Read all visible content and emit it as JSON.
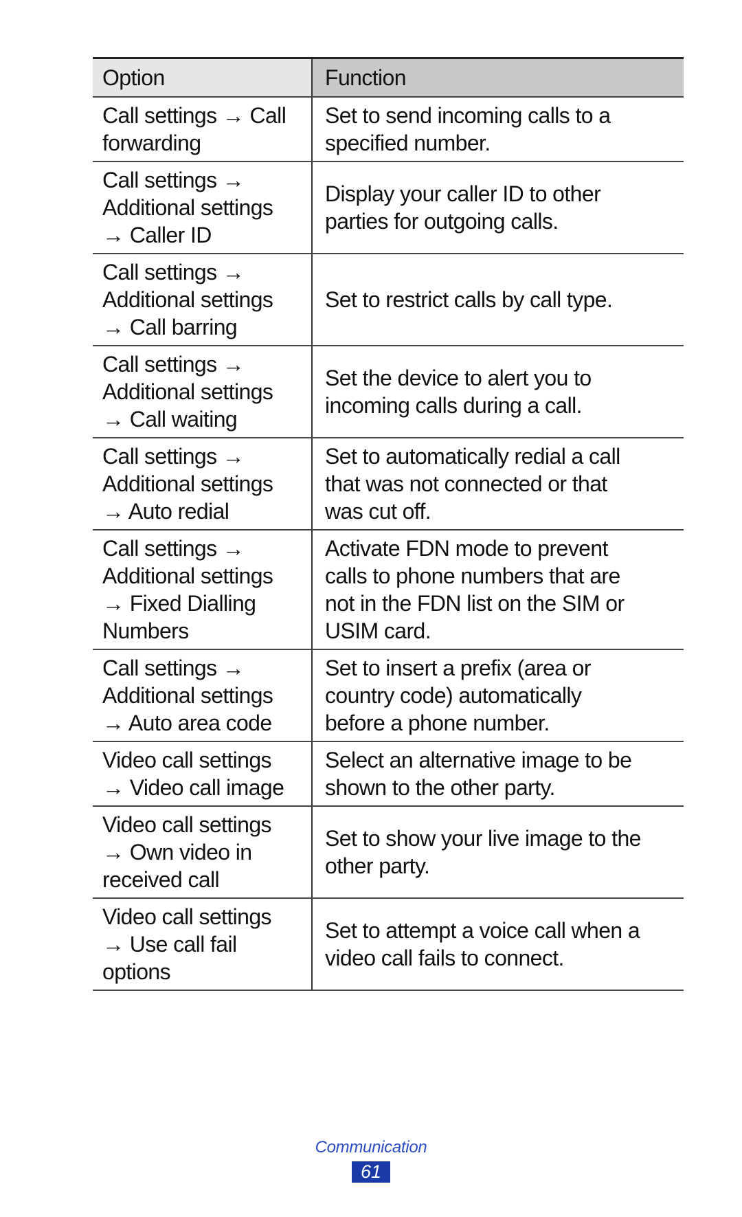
{
  "table": {
    "headers": {
      "option": "Option",
      "function": "Function"
    },
    "rows": [
      {
        "option": [
          "Call settings → Call",
          "forwarding"
        ],
        "function": [
          "Set to send incoming calls to a",
          "specified number."
        ]
      },
      {
        "option": [
          "Call settings →",
          "Additional settings",
          "→ Caller ID"
        ],
        "function": [
          "Display your caller ID to other",
          "parties for outgoing calls."
        ]
      },
      {
        "option": [
          "Call settings →",
          "Additional settings",
          "→ Call barring"
        ],
        "function": [
          "Set to restrict calls by call type."
        ]
      },
      {
        "option": [
          "Call settings →",
          "Additional settings",
          "→ Call waiting"
        ],
        "function": [
          "Set the device to alert you to",
          "incoming calls during a call."
        ]
      },
      {
        "option": [
          "Call settings →",
          "Additional settings",
          "→ Auto redial"
        ],
        "function": [
          "Set to automatically redial a call",
          "that was not connected or that",
          "was cut off."
        ]
      },
      {
        "option": [
          "Call settings →",
          "Additional settings",
          "→ Fixed Dialling",
          "Numbers"
        ],
        "function": [
          "Activate FDN mode to prevent",
          "calls to phone numbers that are",
          "not in the FDN list on the SIM or",
          "USIM card."
        ]
      },
      {
        "option": [
          "Call settings →",
          "Additional settings",
          "→ Auto area code"
        ],
        "function": [
          "Set to insert a prefix (area or",
          "country code) automatically",
          "before a phone number."
        ]
      },
      {
        "option": [
          "Video call settings",
          "→ Video call image"
        ],
        "function": [
          "Select an alternative image to be",
          "shown to the other party."
        ]
      },
      {
        "option": [
          "Video call settings",
          "→ Own video in",
          "received call"
        ],
        "function": [
          "Set to show your live image to the",
          "other party."
        ]
      },
      {
        "option": [
          "Video call settings",
          "→ Use call fail",
          "options"
        ],
        "function": [
          "Set to attempt a voice call when a",
          "video call fails to connect."
        ]
      }
    ]
  },
  "footer": {
    "section": "Communication",
    "page_number": "61"
  },
  "colors": {
    "header_option_bg": "#e6e6e6",
    "header_function_bg": "#c8c8c8",
    "footer_text": "#2a4cc4",
    "page_badge_bg": "#1b3aa8"
  }
}
